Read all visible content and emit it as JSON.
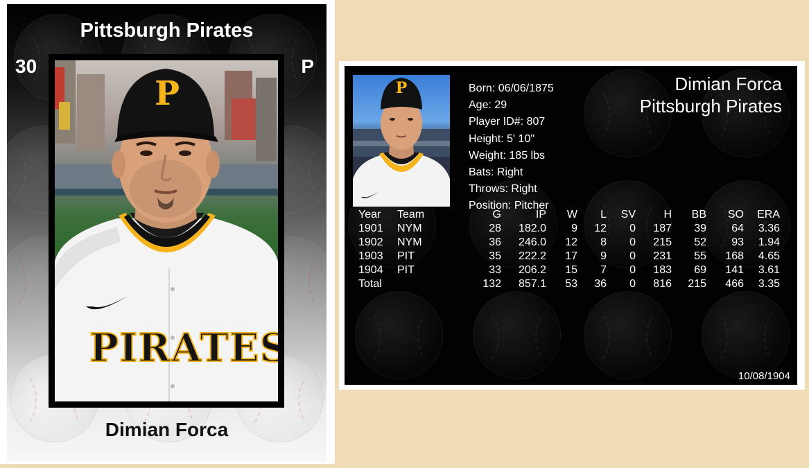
{
  "front": {
    "team": "Pittsburgh Pirates",
    "number": "30",
    "position": "P",
    "name": "Dimian Forca",
    "cap_letter": "P",
    "jersey_text": "PIRATES"
  },
  "back": {
    "name": "Dimian Forca",
    "team": "Pittsburgh Pirates",
    "cap_letter": "P",
    "bio": {
      "born": "Born: 06/06/1875",
      "age": "Age: 29",
      "player_id": "Player ID#: 807",
      "height": "Height: 5' 10\"",
      "weight": "Weight: 185 lbs",
      "bats": "Bats: Right",
      "throws": "Throws: Right",
      "position": "Position: Pitcher"
    },
    "stats": {
      "headers": [
        "Year",
        "Team",
        "G",
        "IP",
        "W",
        "L",
        "SV",
        "H",
        "BB",
        "SO",
        "ERA"
      ],
      "rows": [
        [
          "1901",
          "NYM",
          "28",
          "182.0",
          "9",
          "12",
          "0",
          "187",
          "39",
          "64",
          "3.36"
        ],
        [
          "1902",
          "NYM",
          "36",
          "246.0",
          "12",
          "8",
          "0",
          "215",
          "52",
          "93",
          "1.94"
        ],
        [
          "1903",
          "PIT",
          "35",
          "222.2",
          "17",
          "9",
          "0",
          "231",
          "55",
          "168",
          "4.65"
        ],
        [
          "1904",
          "PIT",
          "33",
          "206.2",
          "15",
          "7",
          "0",
          "183",
          "69",
          "141",
          "3.61"
        ],
        [
          "Total",
          "",
          "132",
          "857.1",
          "53",
          "36",
          "0",
          "816",
          "215",
          "466",
          "3.35"
        ]
      ]
    },
    "date": "10/08/1904"
  },
  "colors": {
    "page_background": "#efdcb6",
    "pirates_gold": "#f5b41c",
    "pirates_black": "#111111"
  }
}
